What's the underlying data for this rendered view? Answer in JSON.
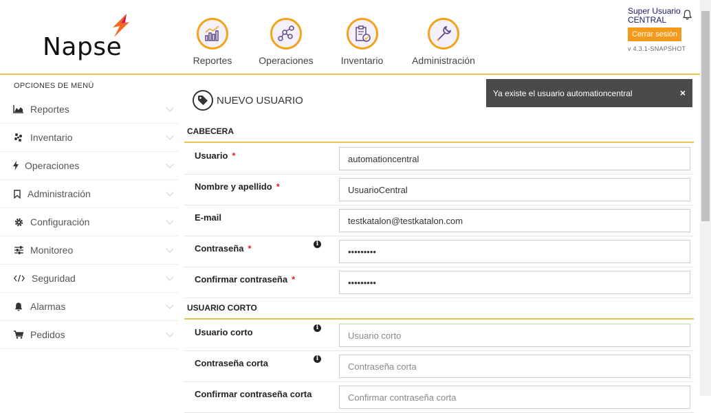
{
  "brand": {
    "name": "Napse"
  },
  "nav": [
    {
      "label": "Reportes",
      "icon": "chart-icon"
    },
    {
      "label": "Operaciones",
      "icon": "network-icon"
    },
    {
      "label": "Inventario",
      "icon": "clipboard-check-icon"
    },
    {
      "label": "Administración",
      "icon": "wrench-icon"
    }
  ],
  "user": {
    "role": "Super Usuario",
    "store": "CENTRAL",
    "logout_label": "Cerrar sesión",
    "version": "v 4.3.1-SNAPSHOT"
  },
  "sidebar": {
    "title": "OPCIONES DE MENÚ",
    "items": [
      {
        "label": "Reportes",
        "icon": "area-chart-icon"
      },
      {
        "label": "Inventario",
        "icon": "yelp-icon"
      },
      {
        "label": "Operaciones",
        "icon": "bolt-icon"
      },
      {
        "label": "Administración",
        "icon": "bookmark-icon"
      },
      {
        "label": "Configuración",
        "icon": "gear-icon"
      },
      {
        "label": "Monitoreo",
        "icon": "sliders-icon"
      },
      {
        "label": "Seguridad",
        "icon": "code-icon"
      },
      {
        "label": "Alarmas",
        "icon": "bell-icon"
      },
      {
        "label": "Pedidos",
        "icon": "cart-icon"
      }
    ]
  },
  "page": {
    "title": "NUEVO USUARIO"
  },
  "toast": {
    "message": "Ya existe el usuario automationcentral",
    "close": "×"
  },
  "sections": {
    "cabecera": "CABECERA",
    "usuario_corto": "USUARIO CORTO"
  },
  "form": {
    "usuario": {
      "label": "Usuario",
      "value": "automationcentral",
      "required": "*"
    },
    "nombre": {
      "label": "Nombre y apellido",
      "value": "UsuarioCentral",
      "required": "*"
    },
    "email": {
      "label": "E-mail",
      "value": "testkatalon@testkatalon.com"
    },
    "password": {
      "label": "Contraseña",
      "value": "•••••••••",
      "required": "*"
    },
    "confirm_password": {
      "label": "Confirmar contraseña",
      "value": "•••••••••",
      "required": "*"
    },
    "usuario_corto": {
      "label": "Usuario corto",
      "placeholder": "Usuario corto"
    },
    "password_corta": {
      "label": "Contraseña corta",
      "placeholder": "Contraseña corta"
    },
    "confirm_password_corta": {
      "label": "Confirmar contraseña corta",
      "placeholder": "Confirmar contraseña corta"
    }
  },
  "colors": {
    "accent": "#f49a1a",
    "divider": "#e9c54a",
    "toast_bg": "#4a4a4a",
    "required": "#d22222"
  }
}
